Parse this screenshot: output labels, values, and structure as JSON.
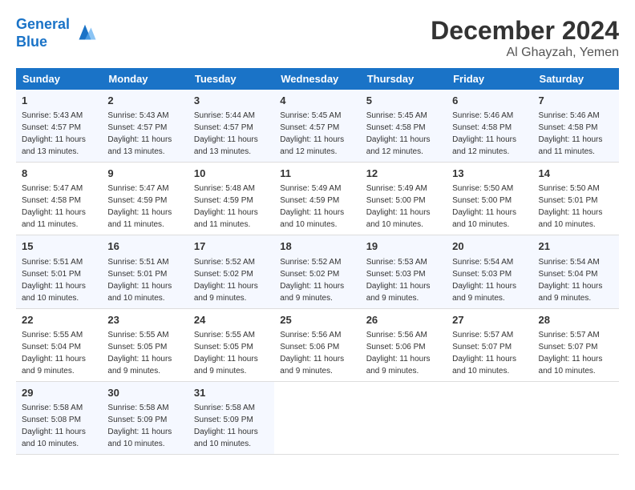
{
  "header": {
    "logo_line1": "General",
    "logo_line2": "Blue",
    "month": "December 2024",
    "location": "Al Ghayzah, Yemen"
  },
  "weekdays": [
    "Sunday",
    "Monday",
    "Tuesday",
    "Wednesday",
    "Thursday",
    "Friday",
    "Saturday"
  ],
  "weeks": [
    [
      {
        "day": "1",
        "sunrise": "5:43 AM",
        "sunset": "4:57 PM",
        "daylight": "11 hours and 13 minutes."
      },
      {
        "day": "2",
        "sunrise": "5:43 AM",
        "sunset": "4:57 PM",
        "daylight": "11 hours and 13 minutes."
      },
      {
        "day": "3",
        "sunrise": "5:44 AM",
        "sunset": "4:57 PM",
        "daylight": "11 hours and 13 minutes."
      },
      {
        "day": "4",
        "sunrise": "5:45 AM",
        "sunset": "4:57 PM",
        "daylight": "11 hours and 12 minutes."
      },
      {
        "day": "5",
        "sunrise": "5:45 AM",
        "sunset": "4:58 PM",
        "daylight": "11 hours and 12 minutes."
      },
      {
        "day": "6",
        "sunrise": "5:46 AM",
        "sunset": "4:58 PM",
        "daylight": "11 hours and 12 minutes."
      },
      {
        "day": "7",
        "sunrise": "5:46 AM",
        "sunset": "4:58 PM",
        "daylight": "11 hours and 11 minutes."
      }
    ],
    [
      {
        "day": "8",
        "sunrise": "5:47 AM",
        "sunset": "4:58 PM",
        "daylight": "11 hours and 11 minutes."
      },
      {
        "day": "9",
        "sunrise": "5:47 AM",
        "sunset": "4:59 PM",
        "daylight": "11 hours and 11 minutes."
      },
      {
        "day": "10",
        "sunrise": "5:48 AM",
        "sunset": "4:59 PM",
        "daylight": "11 hours and 11 minutes."
      },
      {
        "day": "11",
        "sunrise": "5:49 AM",
        "sunset": "4:59 PM",
        "daylight": "11 hours and 10 minutes."
      },
      {
        "day": "12",
        "sunrise": "5:49 AM",
        "sunset": "5:00 PM",
        "daylight": "11 hours and 10 minutes."
      },
      {
        "day": "13",
        "sunrise": "5:50 AM",
        "sunset": "5:00 PM",
        "daylight": "11 hours and 10 minutes."
      },
      {
        "day": "14",
        "sunrise": "5:50 AM",
        "sunset": "5:01 PM",
        "daylight": "11 hours and 10 minutes."
      }
    ],
    [
      {
        "day": "15",
        "sunrise": "5:51 AM",
        "sunset": "5:01 PM",
        "daylight": "11 hours and 10 minutes."
      },
      {
        "day": "16",
        "sunrise": "5:51 AM",
        "sunset": "5:01 PM",
        "daylight": "11 hours and 10 minutes."
      },
      {
        "day": "17",
        "sunrise": "5:52 AM",
        "sunset": "5:02 PM",
        "daylight": "11 hours and 9 minutes."
      },
      {
        "day": "18",
        "sunrise": "5:52 AM",
        "sunset": "5:02 PM",
        "daylight": "11 hours and 9 minutes."
      },
      {
        "day": "19",
        "sunrise": "5:53 AM",
        "sunset": "5:03 PM",
        "daylight": "11 hours and 9 minutes."
      },
      {
        "day": "20",
        "sunrise": "5:54 AM",
        "sunset": "5:03 PM",
        "daylight": "11 hours and 9 minutes."
      },
      {
        "day": "21",
        "sunrise": "5:54 AM",
        "sunset": "5:04 PM",
        "daylight": "11 hours and 9 minutes."
      }
    ],
    [
      {
        "day": "22",
        "sunrise": "5:55 AM",
        "sunset": "5:04 PM",
        "daylight": "11 hours and 9 minutes."
      },
      {
        "day": "23",
        "sunrise": "5:55 AM",
        "sunset": "5:05 PM",
        "daylight": "11 hours and 9 minutes."
      },
      {
        "day": "24",
        "sunrise": "5:55 AM",
        "sunset": "5:05 PM",
        "daylight": "11 hours and 9 minutes."
      },
      {
        "day": "25",
        "sunrise": "5:56 AM",
        "sunset": "5:06 PM",
        "daylight": "11 hours and 9 minutes."
      },
      {
        "day": "26",
        "sunrise": "5:56 AM",
        "sunset": "5:06 PM",
        "daylight": "11 hours and 9 minutes."
      },
      {
        "day": "27",
        "sunrise": "5:57 AM",
        "sunset": "5:07 PM",
        "daylight": "11 hours and 10 minutes."
      },
      {
        "day": "28",
        "sunrise": "5:57 AM",
        "sunset": "5:07 PM",
        "daylight": "11 hours and 10 minutes."
      }
    ],
    [
      {
        "day": "29",
        "sunrise": "5:58 AM",
        "sunset": "5:08 PM",
        "daylight": "11 hours and 10 minutes."
      },
      {
        "day": "30",
        "sunrise": "5:58 AM",
        "sunset": "5:09 PM",
        "daylight": "11 hours and 10 minutes."
      },
      {
        "day": "31",
        "sunrise": "5:58 AM",
        "sunset": "5:09 PM",
        "daylight": "11 hours and 10 minutes."
      },
      null,
      null,
      null,
      null
    ]
  ]
}
